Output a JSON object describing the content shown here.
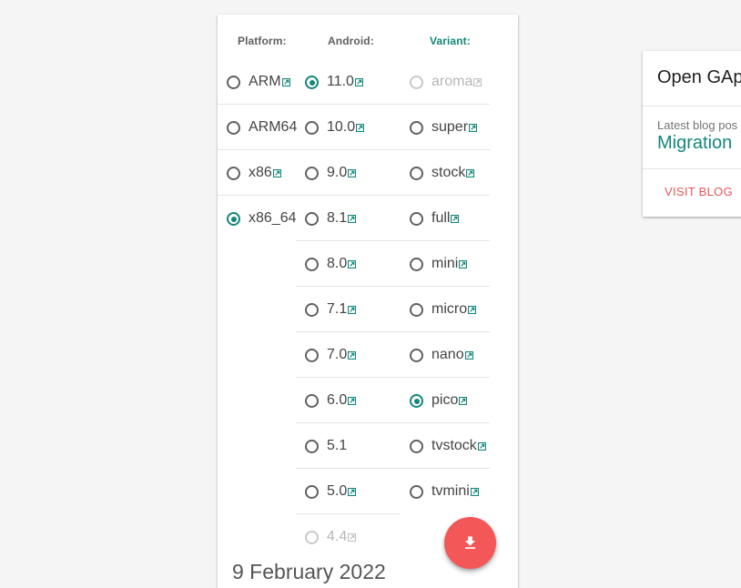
{
  "selector": {
    "platform": {
      "header": "Platform:",
      "options": [
        {
          "label": "ARM",
          "link": true,
          "selected": false,
          "disabled": false
        },
        {
          "label": "ARM64",
          "link": false,
          "selected": false,
          "disabled": false
        },
        {
          "label": "x86",
          "link": true,
          "selected": false,
          "disabled": false
        },
        {
          "label": "x86_64",
          "link": false,
          "selected": true,
          "disabled": false
        }
      ]
    },
    "android": {
      "header": "Android:",
      "options": [
        {
          "label": "11.0",
          "link": true,
          "selected": true,
          "disabled": false
        },
        {
          "label": "10.0",
          "link": true,
          "selected": false,
          "disabled": false
        },
        {
          "label": "9.0",
          "link": true,
          "selected": false,
          "disabled": false
        },
        {
          "label": "8.1",
          "link": true,
          "selected": false,
          "disabled": false
        },
        {
          "label": "8.0",
          "link": true,
          "selected": false,
          "disabled": false
        },
        {
          "label": "7.1",
          "link": true,
          "selected": false,
          "disabled": false
        },
        {
          "label": "7.0",
          "link": true,
          "selected": false,
          "disabled": false
        },
        {
          "label": "6.0",
          "link": true,
          "selected": false,
          "disabled": false
        },
        {
          "label": "5.1",
          "link": false,
          "selected": false,
          "disabled": false
        },
        {
          "label": "5.0",
          "link": true,
          "selected": false,
          "disabled": false
        },
        {
          "label": "4.4",
          "link": true,
          "selected": false,
          "disabled": true
        }
      ]
    },
    "variant": {
      "header": "Variant:",
      "options": [
        {
          "label": "aroma",
          "link": true,
          "selected": false,
          "disabled": true
        },
        {
          "label": "super",
          "link": true,
          "selected": false,
          "disabled": false
        },
        {
          "label": "stock",
          "link": true,
          "selected": false,
          "disabled": false
        },
        {
          "label": "full",
          "link": true,
          "selected": false,
          "disabled": false
        },
        {
          "label": "mini",
          "link": true,
          "selected": false,
          "disabled": false
        },
        {
          "label": "micro",
          "link": true,
          "selected": false,
          "disabled": false
        },
        {
          "label": "nano",
          "link": true,
          "selected": false,
          "disabled": false
        },
        {
          "label": "pico",
          "link": true,
          "selected": true,
          "disabled": false
        },
        {
          "label": "tvstock",
          "link": true,
          "selected": false,
          "disabled": false
        },
        {
          "label": "tvmini",
          "link": true,
          "selected": false,
          "disabled": false
        }
      ]
    },
    "date": "9 February 2022",
    "download_icon": "download-icon"
  },
  "blog": {
    "title": "Open GAp",
    "subtitle": "Latest blog pos",
    "post_title": "Migration",
    "button_label": "VISIT BLOG"
  },
  "colors": {
    "accent": "#13877a",
    "fab": "#f45757",
    "blog_button": "#e8565a",
    "background": "#f5f5f5"
  }
}
